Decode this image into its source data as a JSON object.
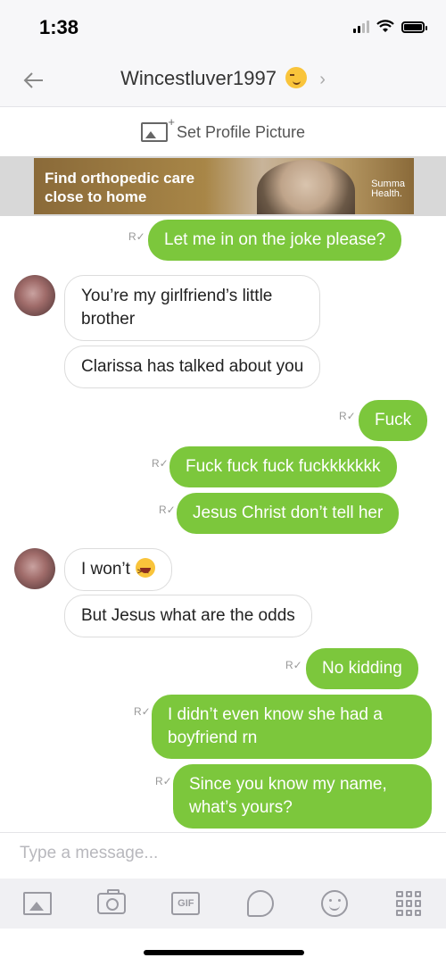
{
  "status_bar": {
    "time": "1:38"
  },
  "header": {
    "title": "Wincestluver1997",
    "back_icon": "back-arrow-icon",
    "chevron": "›"
  },
  "profile_prompt": {
    "label": "Set Profile Picture"
  },
  "ad": {
    "text_line1": "Find orthopedic care",
    "text_line2": "close to home",
    "brand_line1": "Summa",
    "brand_line2": "Health."
  },
  "messages": [
    {
      "from": "me",
      "text": "Let me in on the joke please?"
    },
    {
      "from": "them",
      "text": "You’re my girlfriend’s little brother"
    },
    {
      "from": "them",
      "text": "Clarissa has talked about you"
    },
    {
      "from": "me",
      "text": "Fuck"
    },
    {
      "from": "me",
      "text": "Fuck fuck fuck fuckkkkkkk"
    },
    {
      "from": "me",
      "text": "Jesus Christ don’t tell her"
    },
    {
      "from": "them",
      "text": "I won’t"
    },
    {
      "from": "them",
      "text": "But Jesus what are the odds"
    },
    {
      "from": "me",
      "text": "No kidding"
    },
    {
      "from": "me",
      "text": "I didn’t even know she had a boyfriend rn"
    },
    {
      "from": "me",
      "text": "Since you know my name, what’s yours?"
    }
  ],
  "read_receipt": "R",
  "composer": {
    "placeholder": "Type a message..."
  },
  "toolbar": {
    "gif_label": "GIF"
  },
  "colors": {
    "outgoing_bubble": "#7cc73c",
    "incoming_bubble": "#ffffff"
  }
}
